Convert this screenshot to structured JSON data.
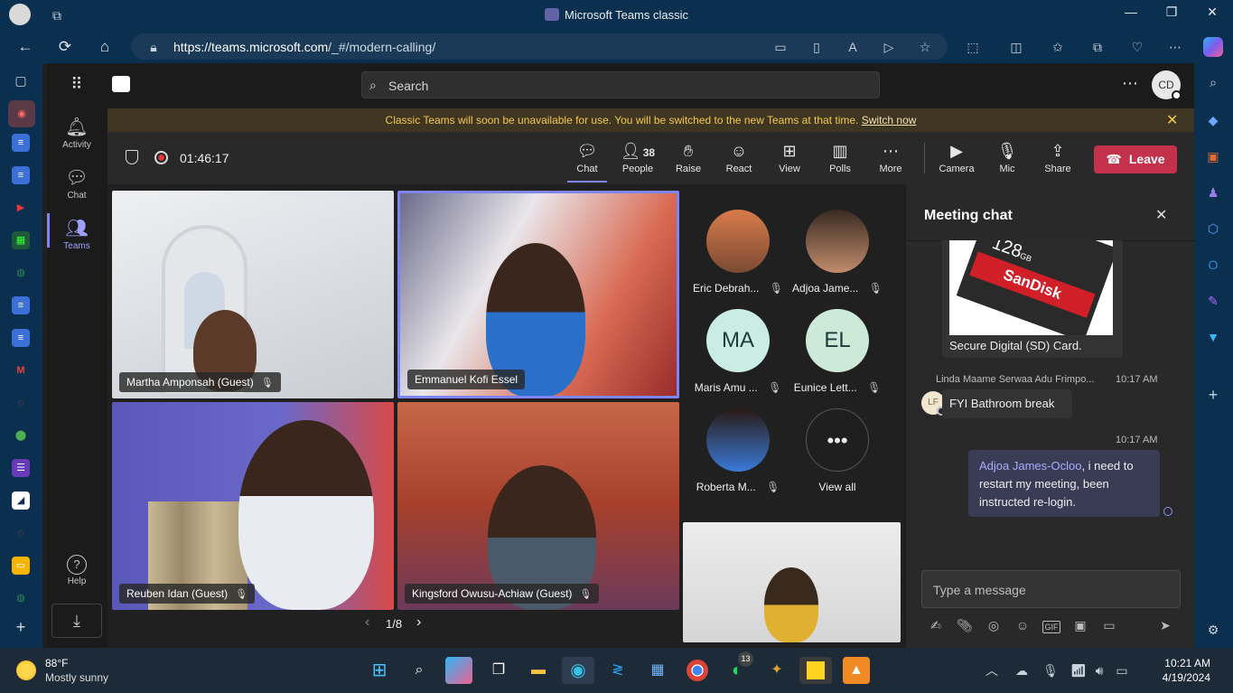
{
  "browser": {
    "window_title": "Microsoft Teams classic",
    "url_host": "https://teams.microsoft.com",
    "url_path": "/_#/modern-calling/",
    "minimize": "—",
    "maximize": "❐",
    "close": "✕"
  },
  "teams": {
    "search_placeholder": "Search",
    "user_initials": "CD",
    "rail": [
      {
        "label": "Activity",
        "icon": "bell-icon"
      },
      {
        "label": "Chat",
        "icon": "chat-icon"
      },
      {
        "label": "Teams",
        "icon": "teams-icon"
      },
      {
        "label": "Help",
        "icon": "help-icon"
      }
    ],
    "banner": {
      "text": "Classic Teams will soon be unavailable for use. You will be switched to the new Teams at that time.",
      "link": "Switch now"
    },
    "meeting": {
      "timer": "01:46:17",
      "controls": [
        {
          "label": "Chat",
          "icon": "chat-icon"
        },
        {
          "label": "People",
          "icon": "people-icon",
          "count": "38"
        },
        {
          "label": "Raise",
          "icon": "hand-icon"
        },
        {
          "label": "React",
          "icon": "smile-icon"
        },
        {
          "label": "View",
          "icon": "grid-icon"
        },
        {
          "label": "Polls",
          "icon": "polls-icon"
        },
        {
          "label": "More",
          "icon": "more-icon"
        },
        {
          "label": "Camera",
          "icon": "camera-icon"
        },
        {
          "label": "Mic",
          "icon": "mic-off-icon"
        },
        {
          "label": "Share",
          "icon": "share-icon"
        }
      ],
      "leave_label": "Leave",
      "videos": [
        {
          "name": "Martha Amponsah (Guest)"
        },
        {
          "name": "Emmanuel Kofi Essel"
        },
        {
          "name": "Reuben Idan (Guest)"
        },
        {
          "name": "Kingsford Owusu-Achiaw (Guest)"
        }
      ],
      "pagination": "1/8",
      "avatars": [
        {
          "name": "Eric Debrah...",
          "initials": ""
        },
        {
          "name": "Adjoa Jame...",
          "initials": ""
        },
        {
          "name": "Maris Amu ...",
          "initials": "MA"
        },
        {
          "name": "Eunice Lett...",
          "initials": "EL"
        },
        {
          "name": "Roberta M...",
          "initials": ""
        }
      ],
      "view_all": "View all"
    },
    "chat": {
      "header": "Meeting chat",
      "sd_card_brand": "SanDisk",
      "sd_card_size": "128",
      "sd_card_unit": "GB",
      "sd_caption": "Secure Digital (SD) Card.",
      "msg1": {
        "sender": "Linda Maame Serwaa Adu Frimpo...",
        "time": "10:17 AM",
        "initials": "LF",
        "text": "FYI Bathroom break"
      },
      "msg2": {
        "time": "10:17 AM",
        "mention": "Adjoa James-Ocloo",
        "text": ", i need to restart my meeting, been instructed re-login."
      },
      "composer_placeholder": "Type a message"
    }
  },
  "taskbar": {
    "weather_temp": "88°F",
    "weather_text": "Mostly sunny",
    "whatsapp_badge": "13",
    "time": "10:21 AM",
    "date": "4/19/2024"
  }
}
